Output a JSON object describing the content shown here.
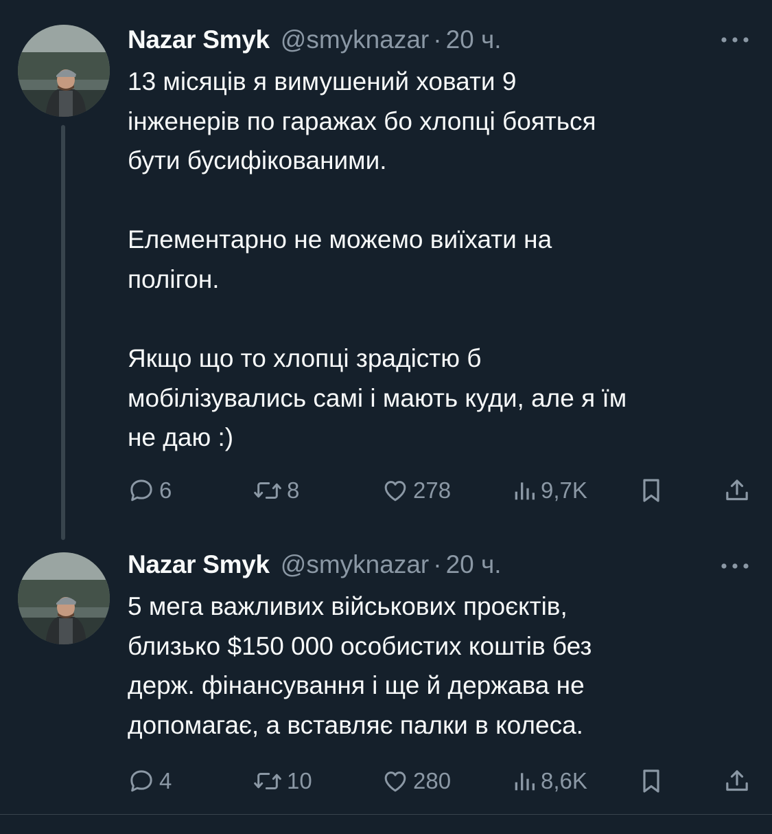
{
  "colors": {
    "background": "#15202b",
    "text_primary": "#f7f9f9",
    "text_secondary": "#8b98a5",
    "thread_line": "#38444d"
  },
  "tweets": [
    {
      "author": {
        "name": "Nazar Smyk",
        "handle": "@smyknazar",
        "separator": "·",
        "time": "20 ч."
      },
      "text": "13 місяців я вимушений ховати 9\nінженерів по гаражах бо хлопці бояться\nбути бусифікованими.\n\nЕлементарно не можемо виїхати на\nполігон.\n\nЯкщо що то хлопці зрадістю б\nмобілізувались самі і мають куди, але я їм\nне даю :)",
      "stats": {
        "replies": "6",
        "retweets": "8",
        "likes": "278",
        "views": "9,7K"
      }
    },
    {
      "author": {
        "name": "Nazar Smyk",
        "handle": "@smyknazar",
        "separator": "·",
        "time": "20 ч."
      },
      "text": "5 мега важливих військових проєктів,\nблизько $150 000 особистих коштів без\nдерж. фінансування і ще й держава не\nдопомагає, а вставляє палки в колеса.",
      "stats": {
        "replies": "4",
        "retweets": "10",
        "likes": "280",
        "views": "8,6K"
      }
    }
  ],
  "icons": {
    "reply": "speech-bubble-icon",
    "retweet": "retweet-arrows-icon",
    "like": "heart-icon",
    "views": "bar-chart-icon",
    "bookmark": "bookmark-icon",
    "share": "share-upload-icon",
    "more": "three-dots-icon"
  }
}
